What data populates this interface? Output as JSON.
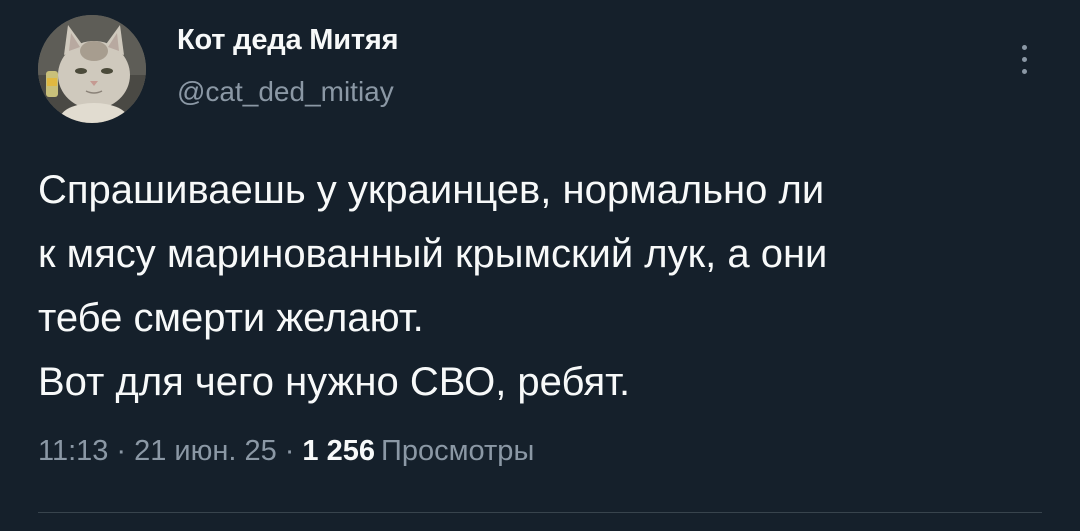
{
  "author": {
    "display_name": "Кот деда Митяя",
    "handle": "@cat_ded_mitiay",
    "avatar_icon": "cat-photo-avatar"
  },
  "tweet": {
    "lines": [
      "Спрашиваешь у украинцев, нормально ли",
      "к мясу маринованный крымский лук, а они",
      "тебе смерти желают.",
      "Вот для чего нужно СВО, ребят."
    ]
  },
  "meta": {
    "time": "11:13",
    "separator": "·",
    "date": "21 июн. 25",
    "views_count": "1 256",
    "views_label": "Просмотры"
  },
  "icons": {
    "more": "more-vertical-icon"
  },
  "colors": {
    "background": "#15202b",
    "text_primary": "#f7f9f9",
    "text_secondary": "#8b98a5",
    "divider": "#38444d"
  }
}
